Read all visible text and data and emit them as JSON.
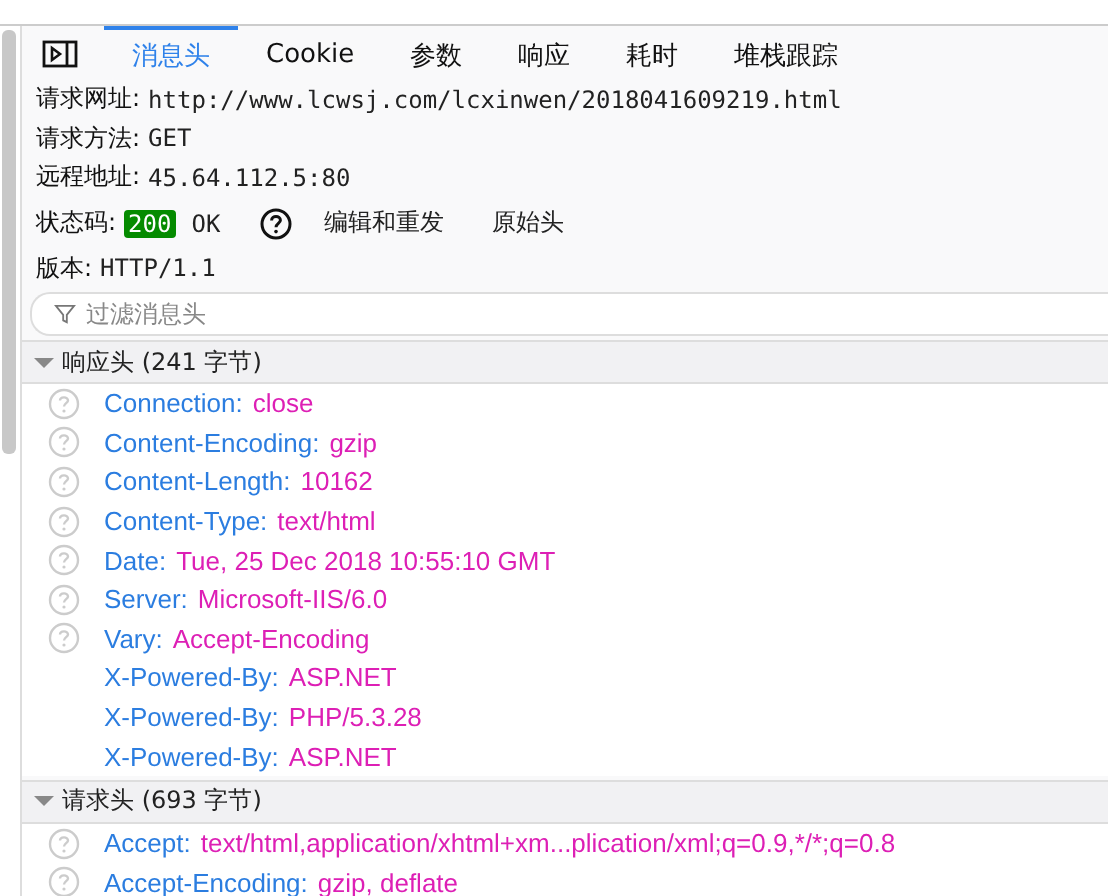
{
  "tabs": [
    {
      "label": "消息头",
      "selected": true
    },
    {
      "label": "Cookie",
      "selected": false
    },
    {
      "label": "参数",
      "selected": false
    },
    {
      "label": "响应",
      "selected": false
    },
    {
      "label": "耗时",
      "selected": false
    },
    {
      "label": "堆栈跟踪",
      "selected": false
    }
  ],
  "summary": [
    {
      "label": "请求网址:",
      "value": "http://www.lcwsj.com/lcxinwen/2018041609219.html"
    },
    {
      "label": "请求方法:",
      "value": "GET"
    },
    {
      "label": "远程地址:",
      "value": "45.64.112.5:80"
    }
  ],
  "status": {
    "label": "状态码:",
    "code": "200",
    "text": "OK",
    "actions": [
      "编辑和重发",
      "原始头"
    ]
  },
  "version": {
    "label": "版本:",
    "value": "HTTP/1.1"
  },
  "filter": {
    "placeholder": "过滤消息头"
  },
  "sections": [
    {
      "title": "响应头 (241 字节)",
      "expanded": true,
      "headers": [
        {
          "name": "Connection:",
          "value": "close",
          "help": true
        },
        {
          "name": "Content-Encoding:",
          "value": "gzip",
          "help": true
        },
        {
          "name": "Content-Length:",
          "value": "10162",
          "help": true
        },
        {
          "name": "Content-Type:",
          "value": "text/html",
          "help": true
        },
        {
          "name": "Date:",
          "value": "Tue, 25 Dec 2018 10:55:10 GMT",
          "help": true
        },
        {
          "name": "Server:",
          "value": "Microsoft-IIS/6.0",
          "help": true
        },
        {
          "name": "Vary:",
          "value": "Accept-Encoding",
          "help": true
        },
        {
          "name": "X-Powered-By:",
          "value": "ASP.NET",
          "help": false
        },
        {
          "name": "X-Powered-By:",
          "value": "PHP/5.3.28",
          "help": false
        },
        {
          "name": "X-Powered-By:",
          "value": "ASP.NET",
          "help": false
        }
      ]
    },
    {
      "title": "请求头 (693 字节)",
      "expanded": true,
      "headers": [
        {
          "name": "Accept:",
          "value": "text/html,application/xhtml+xm...plication/xml;q=0.9,*/*;q=0.8",
          "help": true
        },
        {
          "name": "Accept-Encoding:",
          "value": "gzip, deflate",
          "help": true
        }
      ]
    }
  ]
}
